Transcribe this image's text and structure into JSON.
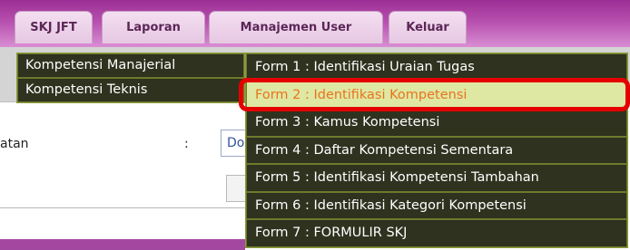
{
  "nav": {
    "tabs": [
      {
        "label": "SKJ JFT"
      },
      {
        "label": "Laporan"
      },
      {
        "label": "Manajemen User"
      },
      {
        "label": "Keluar"
      }
    ]
  },
  "menu": {
    "items": [
      {
        "label": "Kompetensi Manajerial"
      },
      {
        "label": "Kompetensi Teknis"
      }
    ]
  },
  "submenu": {
    "items": [
      {
        "label": "Form 1 : Identifikasi Uraian Tugas"
      },
      {
        "label": "Form 2 : Identifikasi Kompetensi"
      },
      {
        "label": "Form 3 : Kamus Kompetensi"
      },
      {
        "label": "Form 4 : Daftar Kompetensi Sementara"
      },
      {
        "label": "Form 5 : Identifikasi Kompetensi Tambahan"
      },
      {
        "label": "Form 6 : Identifikasi Kategori Kompetensi"
      },
      {
        "label": "Form 7 : FORMULIR SKJ"
      }
    ],
    "active_index": 1
  },
  "form": {
    "label": "atan",
    "colon": ":",
    "value": "Do"
  },
  "colors": {
    "header": "#b64fae",
    "menu_bg": "#2f321f",
    "menu_border": "#8c9a3d",
    "active_bg": "#dfe8a3",
    "active_text": "#e8731e",
    "highlight": "#e50000"
  }
}
